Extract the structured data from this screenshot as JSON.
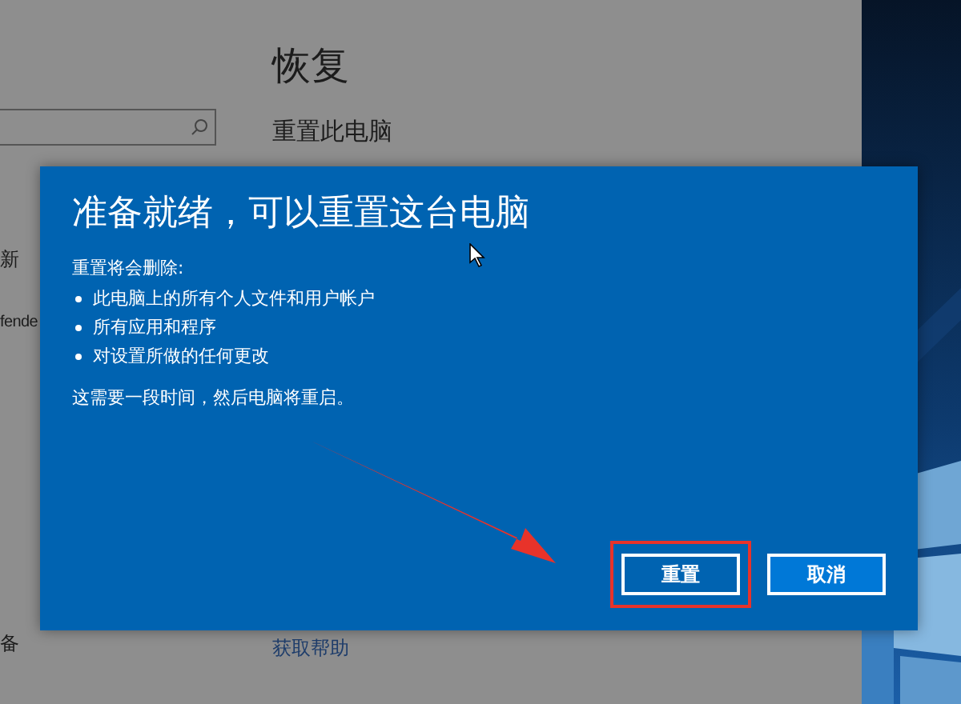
{
  "settings_window": {
    "sidebar": {
      "items": [
        "新",
        "fende",
        "备"
      ]
    },
    "page": {
      "title": "恢复",
      "section": "重置此电脑",
      "help_link": "获取帮助"
    }
  },
  "dialog": {
    "title": "准备就绪，可以重置这台电脑",
    "intro": "重置将会删除:",
    "bullets": [
      "此电脑上的所有个人文件和用户帐户",
      "所有应用和程序",
      "对设置所做的任何更改"
    ],
    "note": "这需要一段时间，然后电脑将重启。",
    "buttons": [
      {
        "label": "重置",
        "kind": "primary",
        "highlighted": true
      },
      {
        "label": "取消",
        "kind": "secondary",
        "highlighted": false
      }
    ]
  }
}
